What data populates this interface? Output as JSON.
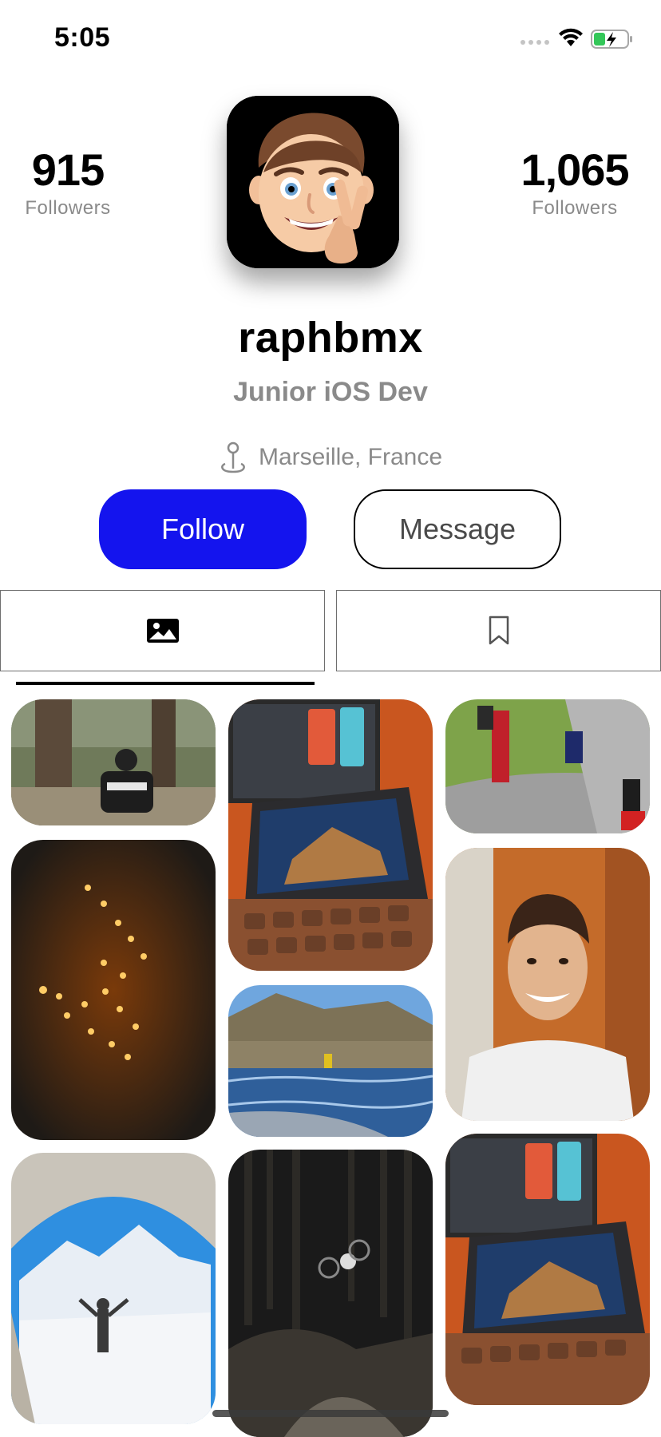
{
  "status_bar": {
    "time": "5:05"
  },
  "profile": {
    "followers_left": {
      "count": "915",
      "label": "Followers"
    },
    "followers_right": {
      "count": "1,065",
      "label": "Followers"
    },
    "username": "raphbmx",
    "role": "Junior iOS Dev",
    "location": "Marseille, France"
  },
  "actions": {
    "follow_label": "Follow",
    "message_label": "Message"
  },
  "tabs": [
    {
      "icon": "photo-icon",
      "selected": true
    },
    {
      "icon": "bookmark-icon",
      "selected": false
    }
  ],
  "colors": {
    "accent": "#1414ee",
    "secondary_text": "#8a8a8a"
  },
  "grid": [
    {
      "subject": "rider-in-forest"
    },
    {
      "subject": "macbook-on-desk"
    },
    {
      "subject": "bmx-race-track"
    },
    {
      "subject": "string-lights-night"
    },
    {
      "subject": "lake-landscape"
    },
    {
      "subject": "smiling-portrait"
    },
    {
      "subject": "snowy-mountain-tunnel"
    },
    {
      "subject": "night-bike-jump"
    },
    {
      "subject": "macbook-on-desk"
    }
  ]
}
